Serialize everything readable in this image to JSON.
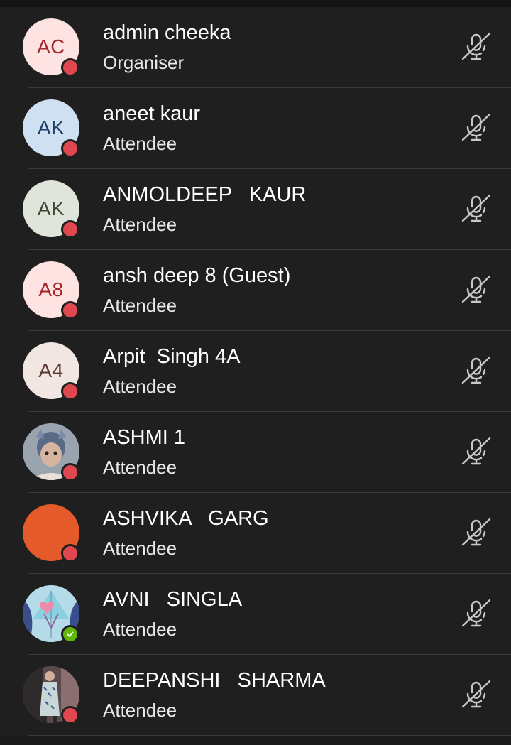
{
  "participants": [
    {
      "name": "admin cheeka",
      "role": "Organiser",
      "initials": "AC",
      "avatar_bg": "#fde3e1",
      "avatar_fg": "#a4262c",
      "status": "busy",
      "has_photo": false
    },
    {
      "name": "aneet kaur",
      "role": "Attendee",
      "initials": "AK",
      "avatar_bg": "#cfe0f2",
      "avatar_fg": "#1d3f66",
      "status": "busy",
      "has_photo": false
    },
    {
      "name": "ANMOLDEEP   KAUR",
      "role": "Attendee",
      "initials": "AK",
      "avatar_bg": "#dfe5da",
      "avatar_fg": "#3c4a33",
      "status": "busy",
      "has_photo": false
    },
    {
      "name": "ansh deep 8 (Guest)",
      "role": "Attendee",
      "initials": "A8",
      "avatar_bg": "#fde3e1",
      "avatar_fg": "#a4262c",
      "status": "busy",
      "has_photo": false
    },
    {
      "name": "Arpit  Singh 4A",
      "role": "Attendee",
      "initials": "A4",
      "avatar_bg": "#f2e6e3",
      "avatar_fg": "#5e3a34",
      "status": "busy",
      "has_photo": false
    },
    {
      "name": "ASHMI 1",
      "role": "Attendee",
      "initials": "",
      "avatar_bg": "#8c97a3",
      "avatar_fg": "#ffffff",
      "status": "busy",
      "has_photo": true
    },
    {
      "name": "ASHVIKA   GARG",
      "role": "Attendee",
      "initials": "",
      "avatar_bg": "#e55a2b",
      "avatar_fg": "#ffffff",
      "status": "busy",
      "has_photo": false
    },
    {
      "name": "AVNI   SINGLA",
      "role": "Attendee",
      "initials": "",
      "avatar_bg": "#7fb6c9",
      "avatar_fg": "#ffffff",
      "status": "available",
      "has_photo": true
    },
    {
      "name": "DEEPANSHI   SHARMA",
      "role": "Attendee",
      "initials": "",
      "avatar_bg": "#6e5a5a",
      "avatar_fg": "#ffffff",
      "status": "busy",
      "has_photo": true
    }
  ],
  "icons": {
    "mic": "mic-off-icon",
    "busy": "busy-presence-icon",
    "available": "available-presence-icon"
  },
  "colors": {
    "busy": "#e0484f",
    "available": "#5fb70a",
    "background": "#1f1f1f",
    "divider": "#3a3a3a",
    "mic": "#c8c8c8"
  }
}
